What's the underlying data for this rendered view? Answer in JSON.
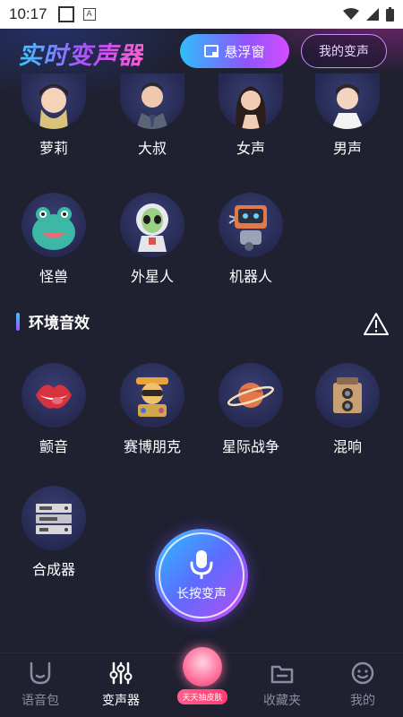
{
  "status_bar": {
    "time": "10:17"
  },
  "header": {
    "title": "实时变声器",
    "float_window_label": "悬浮窗",
    "my_voice_label": "我的变声"
  },
  "voices": [
    {
      "label": "萝莉",
      "icon": "girl-avatar-icon"
    },
    {
      "label": "大叔",
      "icon": "man-avatar-icon"
    },
    {
      "label": "女声",
      "icon": "woman-avatar-icon"
    },
    {
      "label": "男声",
      "icon": "boy-avatar-icon"
    },
    {
      "label": "怪兽",
      "icon": "monster-icon"
    },
    {
      "label": "外星人",
      "icon": "alien-icon"
    },
    {
      "label": "机器人",
      "icon": "robot-icon"
    }
  ],
  "environment": {
    "title": "环境音效",
    "items": [
      {
        "label": "颤音",
        "icon": "lips-icon"
      },
      {
        "label": "赛博朋克",
        "icon": "cyberpunk-icon"
      },
      {
        "label": "星际战争",
        "icon": "planet-icon"
      },
      {
        "label": "混响",
        "icon": "camera-icon"
      },
      {
        "label": "合成器",
        "icon": "synthesizer-icon"
      }
    ]
  },
  "record_button": {
    "label": "长按变声"
  },
  "tabbar": {
    "tabs": [
      {
        "label": "语音包",
        "icon": "voice-pack-icon",
        "active": false
      },
      {
        "label": "变声器",
        "icon": "sliders-icon",
        "active": true
      },
      {
        "label": "收藏夹",
        "icon": "folder-icon",
        "active": false
      },
      {
        "label": "我的",
        "icon": "smile-icon",
        "active": false
      }
    ],
    "promo_label": "天天抽皮肤"
  },
  "colors": {
    "background": "#1f2030",
    "accent_blue": "#36c9ff",
    "accent_purple": "#b44dff",
    "accent_pink": "#ff5fcf"
  }
}
